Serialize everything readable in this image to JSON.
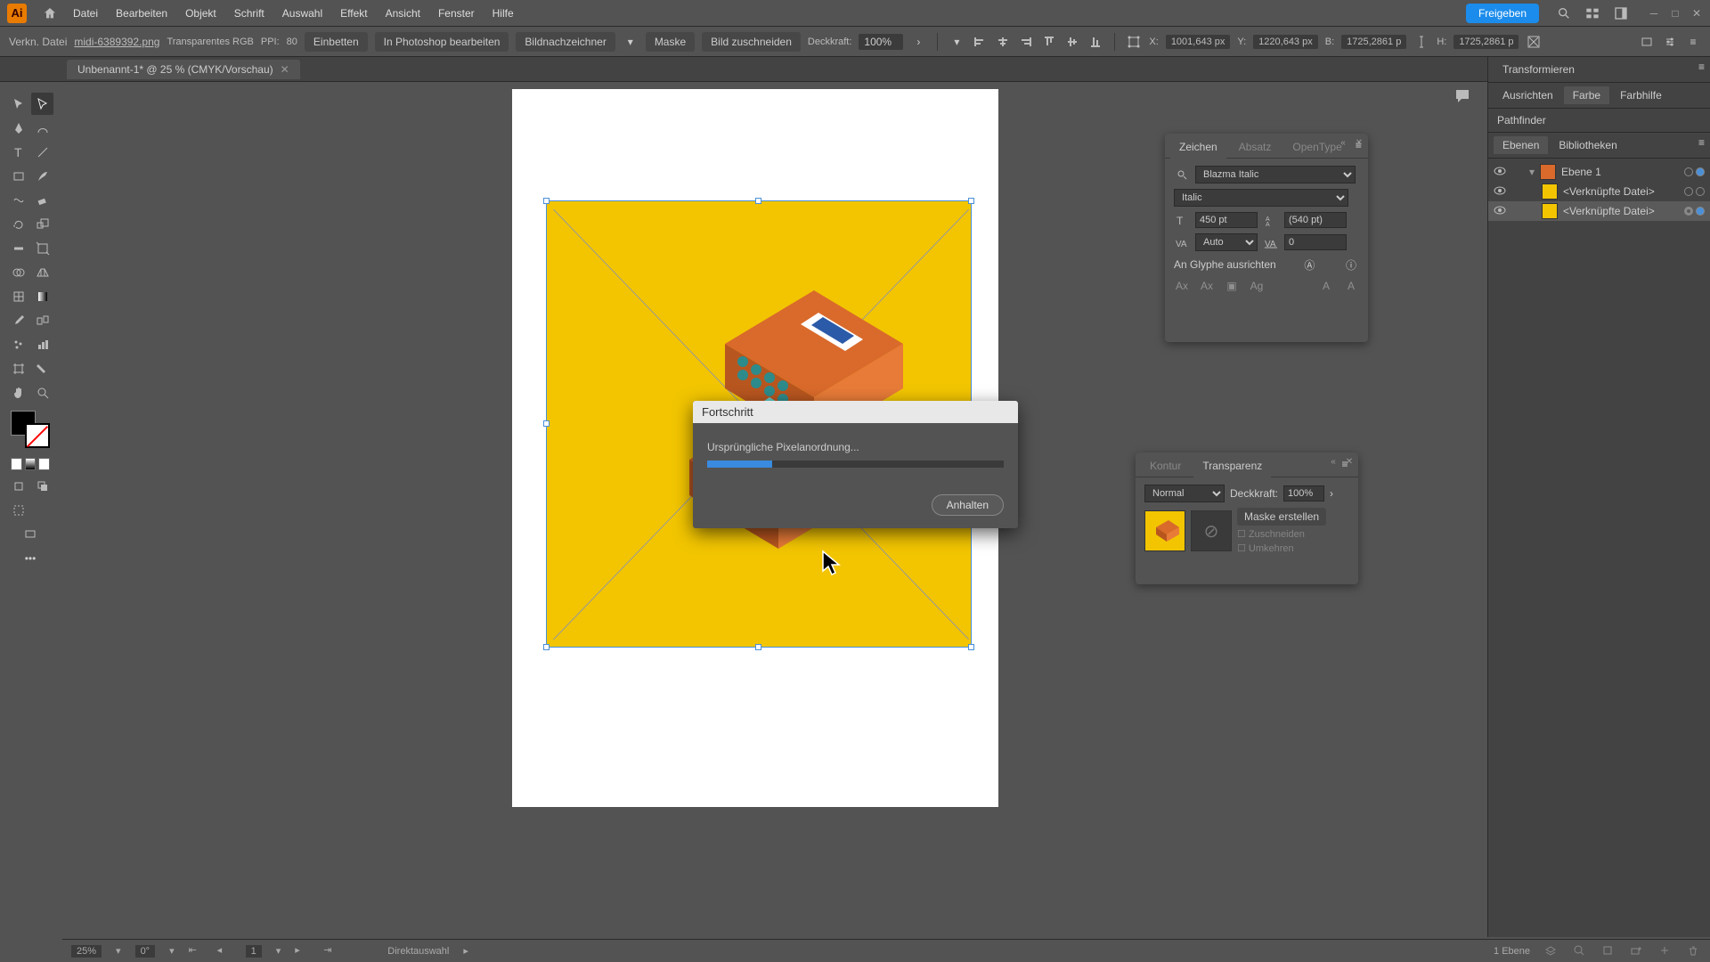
{
  "app": {
    "logo": "Ai"
  },
  "menu": {
    "items": [
      "Datei",
      "Bearbeiten",
      "Objekt",
      "Schrift",
      "Auswahl",
      "Effekt",
      "Ansicht",
      "Fenster",
      "Hilfe"
    ],
    "share": "Freigeben"
  },
  "options": {
    "link_label": "Verkn. Datei",
    "filename": "midi-6389392.png",
    "colormode": "Transparentes RGB",
    "ppi_label": "PPI:",
    "ppi": "80",
    "embed": "Einbetten",
    "ps_edit": "In Photoshop bearbeiten",
    "trace": "Bildnachzeichner",
    "mask": "Maske",
    "crop": "Bild zuschneiden",
    "opacity_label": "Deckkraft:",
    "opacity": "100%",
    "x": "1001,643 px",
    "y": "1220,643 px",
    "w": "1725,2861 p",
    "h": "1725,2861 p"
  },
  "doctab": {
    "name": "Unbenannt-1* @ 25 % (CMYK/Vorschau)"
  },
  "char_panel": {
    "tabs": [
      "Zeichen",
      "Absatz",
      "OpenType"
    ],
    "font": "Blazma Italic",
    "style": "Italic",
    "size": "450 pt",
    "leading": "(540 pt)",
    "kerning": "Auto",
    "tracking": "0",
    "glyph_label": "An Glyphe ausrichten"
  },
  "trans_panel": {
    "tabs": [
      "Kontur",
      "Transparenz"
    ],
    "blend": "Normal",
    "opacity_label": "Deckkraft:",
    "opacity": "100%",
    "make_mask": "Maske erstellen",
    "clip": "Zuschneiden",
    "invert": "Umkehren"
  },
  "right_rail": {
    "row1": [
      "Transformieren"
    ],
    "row2": [
      "Ausrichten",
      "Farbe",
      "Farbhilfe"
    ],
    "pathfinder": "Pathfinder",
    "layer_tabs": [
      "Ebenen",
      "Bibliotheken"
    ],
    "layers": [
      {
        "name": "Ebene 1"
      },
      {
        "name": "<Verknüpfte Datei>"
      },
      {
        "name": "<Verknüpfte Datei>"
      }
    ],
    "layer_count": "1 Ebene"
  },
  "dialog": {
    "title": "Fortschritt",
    "message": "Ursprüngliche Pixelanordnung...",
    "stop": "Anhalten"
  },
  "status": {
    "zoom": "25%",
    "rotate": "0°",
    "artboard": "1",
    "tool": "Direktauswahl"
  }
}
